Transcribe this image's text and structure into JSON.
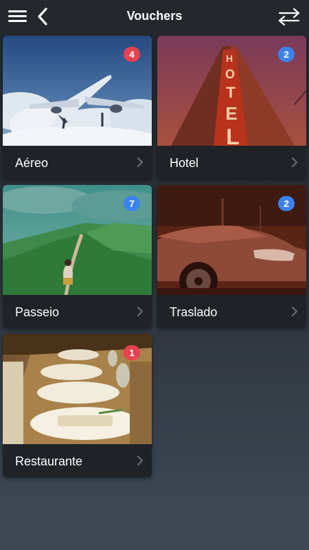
{
  "header": {
    "title": "Vouchers",
    "menu_icon": "hamburger-menu-icon",
    "back_icon": "chevron-left-icon",
    "swap_icon": "swap-arrows-icon"
  },
  "colors": {
    "badge_red": "#e8414f",
    "badge_blue": "#3b82f0",
    "card_footer": "#1f2328",
    "topbar": "#24282d"
  },
  "cards": [
    {
      "label": "Aéreo",
      "badge": "4",
      "badge_color": "red",
      "image": "airplane-in-sky"
    },
    {
      "label": "Hotel",
      "badge": "2",
      "badge_color": "blue",
      "image": "hotel-neon-sign"
    },
    {
      "label": "Passeio",
      "badge": "7",
      "badge_color": "blue",
      "image": "green-mountain-trail"
    },
    {
      "label": "Traslado",
      "badge": "2",
      "badge_color": "blue",
      "image": "car-front"
    },
    {
      "label": "Restaurante",
      "badge": "1",
      "badge_color": "red",
      "image": "dining-table"
    }
  ]
}
